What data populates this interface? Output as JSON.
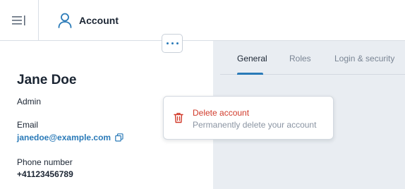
{
  "header": {
    "menu_icon": "sidebar-toggle-icon",
    "page_icon": "user-icon",
    "title": "Account"
  },
  "profile": {
    "name": "Jane Doe",
    "role": "Admin",
    "email_label": "Email",
    "email": "janedoe@example.com",
    "copy_icon": "copy-icon",
    "phone_label": "Phone number",
    "phone": "+41123456789"
  },
  "more_button": {
    "icon": "more-horizontal-icon"
  },
  "tabs": [
    {
      "label": "General",
      "active": true
    },
    {
      "label": "Roles",
      "active": false
    },
    {
      "label": "Login & security",
      "active": false
    }
  ],
  "dropdown": {
    "items": [
      {
        "icon": "trash-icon",
        "label": "Delete account",
        "description": "Permanently delete your account"
      }
    ]
  },
  "colors": {
    "accent": "#2a7ab8",
    "danger": "#d13a2a",
    "text": "#1b2533",
    "muted": "#8a94a2",
    "panel_bg": "#e9edf2"
  }
}
